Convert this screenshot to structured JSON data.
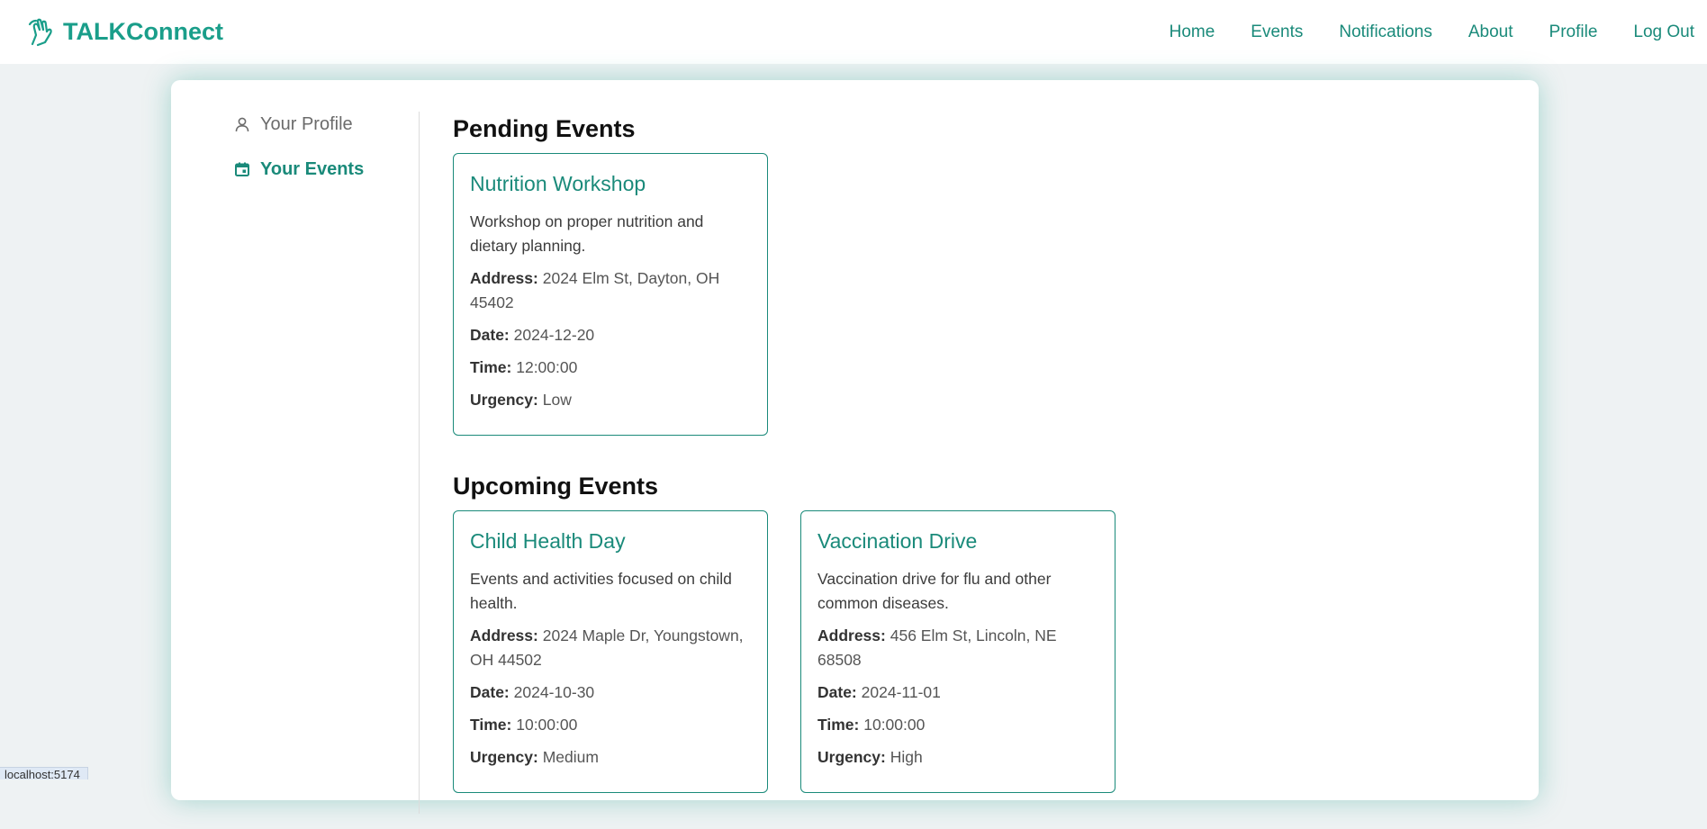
{
  "app": {
    "brand": "TALKConnect",
    "brand_color": "#1a9e8a",
    "accent_color": "#1a8a7a"
  },
  "nav": {
    "links": [
      "Home",
      "Events",
      "Notifications",
      "About",
      "Profile",
      "Log Out"
    ]
  },
  "sidebar": {
    "items": [
      {
        "label": "Your Profile",
        "icon": "user-icon",
        "active": false
      },
      {
        "label": "Your Events",
        "icon": "calendar-icon",
        "active": true
      }
    ]
  },
  "pending": {
    "title": "Pending Events",
    "events": [
      {
        "title": "Nutrition Workshop",
        "description": "Workshop on proper nutrition and dietary planning.",
        "address_label": "Address:",
        "address": "2024 Elm St, Dayton, OH 45402",
        "date_label": "Date:",
        "date": "2024-12-20",
        "time_label": "Time:",
        "time": "12:00:00",
        "urgency_label": "Urgency:",
        "urgency": "Low"
      }
    ]
  },
  "upcoming": {
    "title": "Upcoming Events",
    "events": [
      {
        "title": "Child Health Day",
        "description": "Events and activities focused on child health.",
        "address_label": "Address:",
        "address": "2024 Maple Dr, Youngstown, OH 44502",
        "date_label": "Date:",
        "date": "2024-10-30",
        "time_label": "Time:",
        "time": "10:00:00",
        "urgency_label": "Urgency:",
        "urgency": "Medium"
      },
      {
        "title": "Vaccination Drive",
        "description": "Vaccination drive for flu and other common diseases.",
        "address_label": "Address:",
        "address": "456 Elm St, Lincoln, NE 68508",
        "date_label": "Date:",
        "date": "2024-11-01",
        "time_label": "Time:",
        "time": "10:00:00",
        "urgency_label": "Urgency:",
        "urgency": "High"
      }
    ]
  },
  "status_bar": {
    "url": "localhost:5174"
  }
}
